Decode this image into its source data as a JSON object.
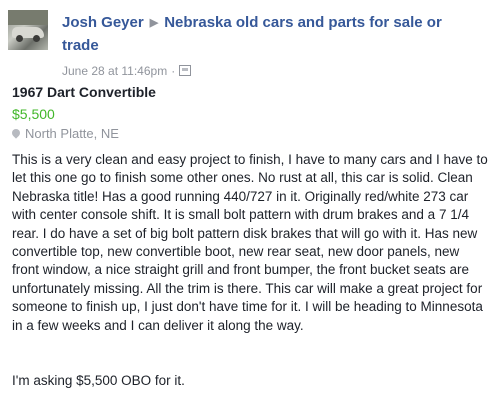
{
  "post": {
    "author": "Josh Geyer",
    "group": "Nebraska old cars and parts for sale or trade",
    "timestamp": "June 28 at 11:46pm",
    "separator": "·"
  },
  "listing": {
    "title": "1967 Dart Convertible",
    "price": "$5,500",
    "location": "North Platte, NE",
    "description": "This is a very clean and easy project to finish, I have to many cars and I have to let this one go to finish some other ones. No rust at all, this car is solid. Clean Nebraska title! Has a good running 440/727 in it. Originally red/white 273 car with center console shift. It is small bolt pattern with drum brakes and a 7 1/4 rear. I do have a set of big bolt pattern disk brakes that will go with it. Has new convertible top, new convertible boot, new rear seat, new door panels, new front window, a nice straight grill and front bumper, the front bucket seats are unfortunately missing. All the trim is there. This car will make a great project for someone to finish up, I just don't have time for it. I will be heading to Minnesota in a few weeks and I can deliver it along the way.",
    "closing": "I'm asking $5,500 OBO for it."
  },
  "icons": {
    "arrow": "▶",
    "audience": "audience-icon",
    "location": "pin-icon"
  },
  "colors": {
    "link": "#365899",
    "price": "#42b72a",
    "meta": "#90949c",
    "text": "#1d2129"
  }
}
